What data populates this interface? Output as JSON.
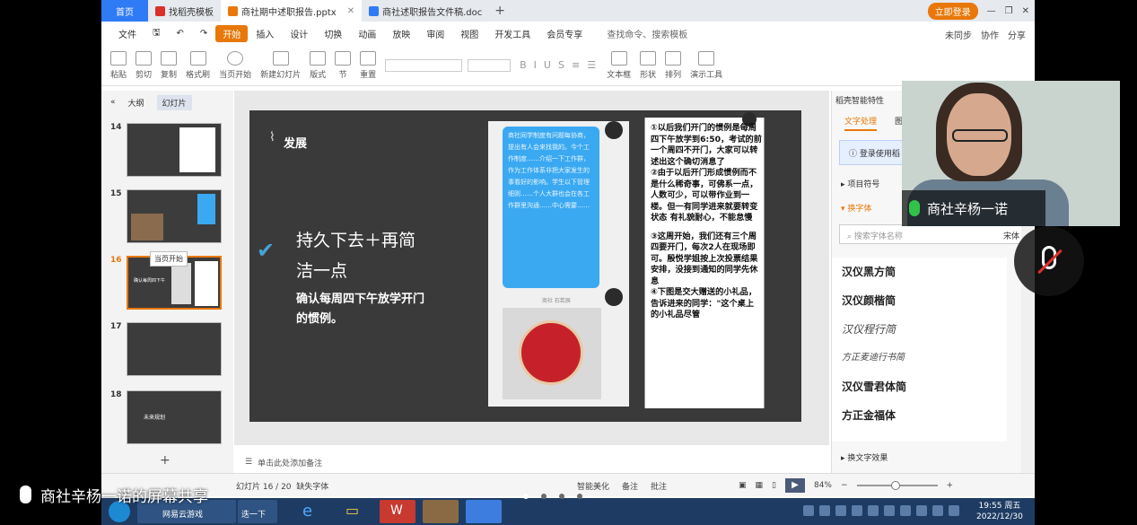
{
  "tabs": {
    "home": "首页",
    "items": [
      {
        "label": "找稻壳模板",
        "color": "#d9302a"
      },
      {
        "label": "商社期中述职报告.pptx",
        "color": "#e8780a"
      },
      {
        "label": "商社述职报告文件稿.doc",
        "color": "#2f7bf5"
      }
    ],
    "login_label": "立即登录"
  },
  "menu": {
    "file": "文件",
    "items": [
      "开始",
      "插入",
      "设计",
      "切换",
      "动画",
      "放映",
      "审阅",
      "视图",
      "开发工具",
      "会员专享"
    ],
    "search": "查找命令、搜索模板",
    "right": [
      "未同步",
      "协作",
      "分享"
    ]
  },
  "ribbon": {
    "buttons": [
      "粘贴",
      "剪切",
      "复制",
      "格式刷",
      "当页开始",
      "新建幻灯片",
      "版式",
      "节",
      "重置"
    ],
    "right": [
      "文本框",
      "形状",
      "排列",
      "演示工具"
    ]
  },
  "left_panel": {
    "tabs": [
      "大纲",
      "幻灯片"
    ],
    "slides": [
      "14",
      "15",
      "16",
      "17",
      "18"
    ],
    "tooltip": "当页开始",
    "thumb16_text": "确认每周四下午",
    "thumb18_text": "未来规划"
  },
  "slide": {
    "title": "发展",
    "main_line1": "持久下去＋再简",
    "main_line2": "洁一点",
    "sub_line1": "确认每周四下午放学开门",
    "sub_line2": "的惯例。",
    "bubble_text": "商社同学制度有问题每协商，提出有人会来找我的。今个工作制度……介绍一下工作群，作为工作体系非把大家发生的事看好的影响。学生以下管理细则……个人大群也会在各工作群里沟通……中心需要……",
    "chat_caption": "商社 石若辰",
    "doc_lines": [
      "①以后我们开门的惯例是每周四下午放学到6:50，考试的前一个周四不开门，大家可以转述出这个确切消息了",
      "②由于以后开门形成惯例而不是什么稀奇事，可佛系一点，人数可少，可以带作业到一楼。但一有同学进来就要转变状态 有礼貌耐心，不能怠慢",
      "③这周开始，我们还有三个周四要开门，每次2人在现场即可。殷悦学姐按上次投票结果安排，没接到通知的同学先休息",
      "④下图是交大赠送的小礼品，告诉进来的同学：\"这个桌上的小礼品尽管"
    ]
  },
  "notes": {
    "placeholder": "单击此处添加备注"
  },
  "status": {
    "slide_info": "幻灯片 16 / 20",
    "missing_font": "缺失字体",
    "beautify": "智能美化",
    "notes": "备注",
    "comments": "批注",
    "zoom": "84%"
  },
  "right_panel": {
    "header": "稻壳智能特性",
    "tabs": [
      "文字处理",
      "图"
    ],
    "info": "登录使用稻",
    "section1": "项目符号",
    "section2": "换字体",
    "search_placeholder": "搜索字体名称",
    "search_value": "宋体",
    "fonts": [
      "汉仪黑方简",
      "汉仪颜楷简",
      "汉仪程行简",
      "方正麦迪行书简",
      "汉仪雪君体简",
      "方正金福体"
    ],
    "bottom": "换文字效果"
  },
  "taskbar": {
    "items": [
      "网易云游戏",
      "迭一下"
    ],
    "time": "19:55 周五",
    "date": "2022/12/30"
  },
  "camera": {
    "name": "商社辛杨一诺"
  },
  "share_banner": "商社辛杨一诺的屏幕共享",
  "colors": {
    "accent": "#e8780a",
    "tab_blue": "#2f7bf5",
    "slide_bg": "#3a3a3a"
  }
}
